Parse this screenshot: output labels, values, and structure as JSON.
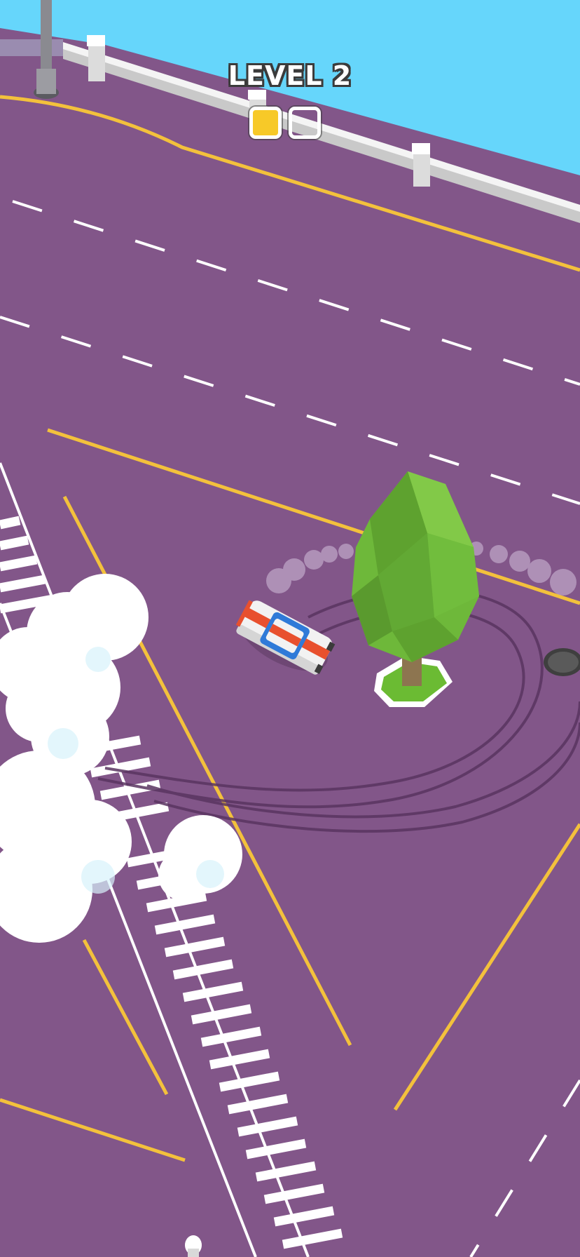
{
  "hud": {
    "level_label": "LEVEL 2",
    "progress": [
      {
        "state": "filled",
        "color": "#f7c928"
      },
      {
        "state": "empty"
      }
    ]
  },
  "colors": {
    "sky": "#66d6fb",
    "asphalt": "#825689",
    "lane_yellow": "#f3c13c",
    "lane_white": "#ffffff",
    "tree_green": "#6eb83a",
    "car_body": "#f2f2f2",
    "car_stripe": "#e8502e",
    "car_glass": "#2f7ad8"
  },
  "scene": {
    "objects": [
      "street-lamp",
      "guard-rail",
      "low-poly-tree",
      "drift-car",
      "manhole-cover",
      "crosswalk",
      "smoke-clouds",
      "skid-marks"
    ]
  }
}
